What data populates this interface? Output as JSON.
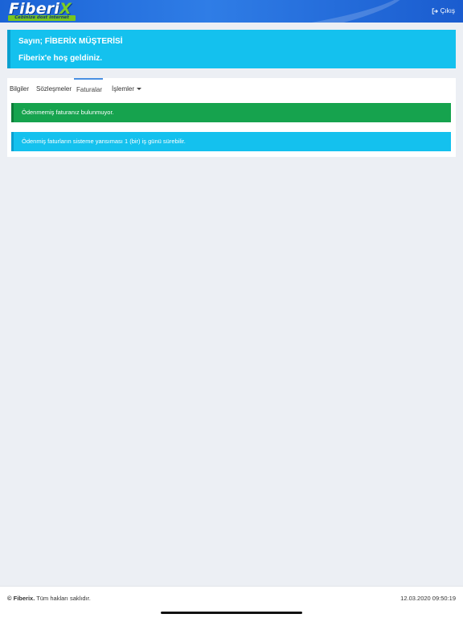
{
  "header": {
    "logo": {
      "word": "Fiberi",
      "word_x": "X",
      "tagline": "Cebinize dost internet"
    },
    "logout_label": "Çıkış",
    "logout_icon": "sign-out-icon"
  },
  "welcome": {
    "greeting_prefix": "Sayın;",
    "customer_name": "FİBERİX MÜŞTERİSİ",
    "message": "Fiberix'e hoş geldiniz."
  },
  "tabs": [
    {
      "label": "Bilgiler",
      "active": false
    },
    {
      "label": "Sözleşmeler",
      "active": false
    },
    {
      "label": "Faturalar",
      "active": true
    },
    {
      "label": "İşlemler",
      "active": false,
      "dropdown": true
    }
  ],
  "alerts": {
    "unpaid": "Ödenmemiş faturanız bulunmuyor.",
    "info": "Ödenmiş faturların sisteme yansıması 1 (bir) iş günü sürebilir."
  },
  "footer": {
    "copyright_symbol": "©",
    "brand": "Fiberix.",
    "rights": "Tüm hakları saklıdır.",
    "timestamp": "12.03.2020 09:50:19"
  },
  "colors": {
    "header_blue": "#1b63d6",
    "info_cyan": "#14c1ee",
    "success_green": "#16a34e",
    "brand_green": "#78c51f"
  }
}
